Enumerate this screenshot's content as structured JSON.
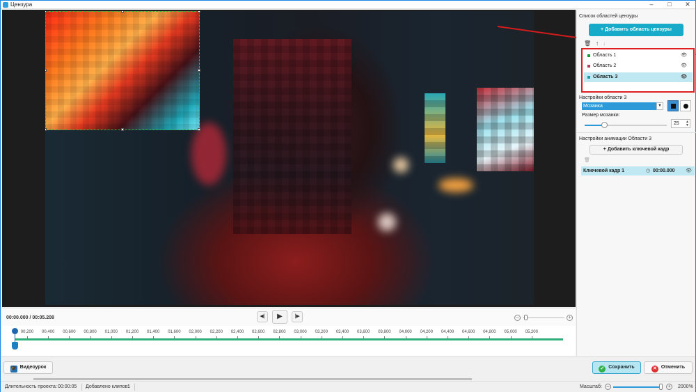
{
  "window": {
    "title": "Цензура",
    "controls": [
      "–",
      "□",
      "✕"
    ]
  },
  "transport": {
    "timecode": "00:00.000 / 00:05.208",
    "prev_icon": "prev-frame-icon",
    "play_icon": "play-icon",
    "next_icon": "next-frame-icon"
  },
  "timeline": {
    "ticks": [
      "00,200",
      "00,400",
      "00,600",
      "00,800",
      "01,000",
      "01,200",
      "01,400",
      "01,600",
      "02,000",
      "02,200",
      "02,400",
      "02,600",
      "02,800",
      "03,000",
      "03,200",
      "03,400",
      "03,600",
      "03,800",
      "04,000",
      "04,200",
      "04,400",
      "04,600",
      "04,800",
      "05,000",
      "05,200"
    ]
  },
  "panel": {
    "areas_title": "Список областей цензуры",
    "add_area_button": "Добавить область цензуры",
    "areas": [
      {
        "label": "Область 1",
        "color": "#1a9a3a",
        "active": false
      },
      {
        "label": "Область 2",
        "color": "#c03a5a",
        "active": false
      },
      {
        "label": "Область 3",
        "color": "#1a9aaa",
        "active": true
      }
    ],
    "settings_title": "Настройки области 3",
    "effect_value": "Мозаика",
    "mosaic_size_label": "Размер мозаики:",
    "mosaic_size_value": "25",
    "mosaic_size_level": 0.24,
    "animation_title": "Настройки анимации Области 3",
    "add_keyframe_button": "Добавить ключевой кадр",
    "keyframe": {
      "name": "Ключевой кадр 1",
      "time": "00:00.000"
    }
  },
  "bottom": {
    "video_lesson_button": "Видеоурок",
    "save_button": "Сохранить",
    "cancel_button": "Отменить"
  },
  "status": {
    "duration_label": "Длительность проекта:",
    "duration_value": "00:00:05",
    "clips_label": "Добавлено клипов:",
    "clips_value": "1",
    "scale_label": "Масштаб:",
    "scale_value": "2000%"
  },
  "colors": {
    "accent": "#18aac9",
    "highlight": "#bfe8f2",
    "annotation_red": "#e02020",
    "timeline_green": "#2fae7a"
  }
}
